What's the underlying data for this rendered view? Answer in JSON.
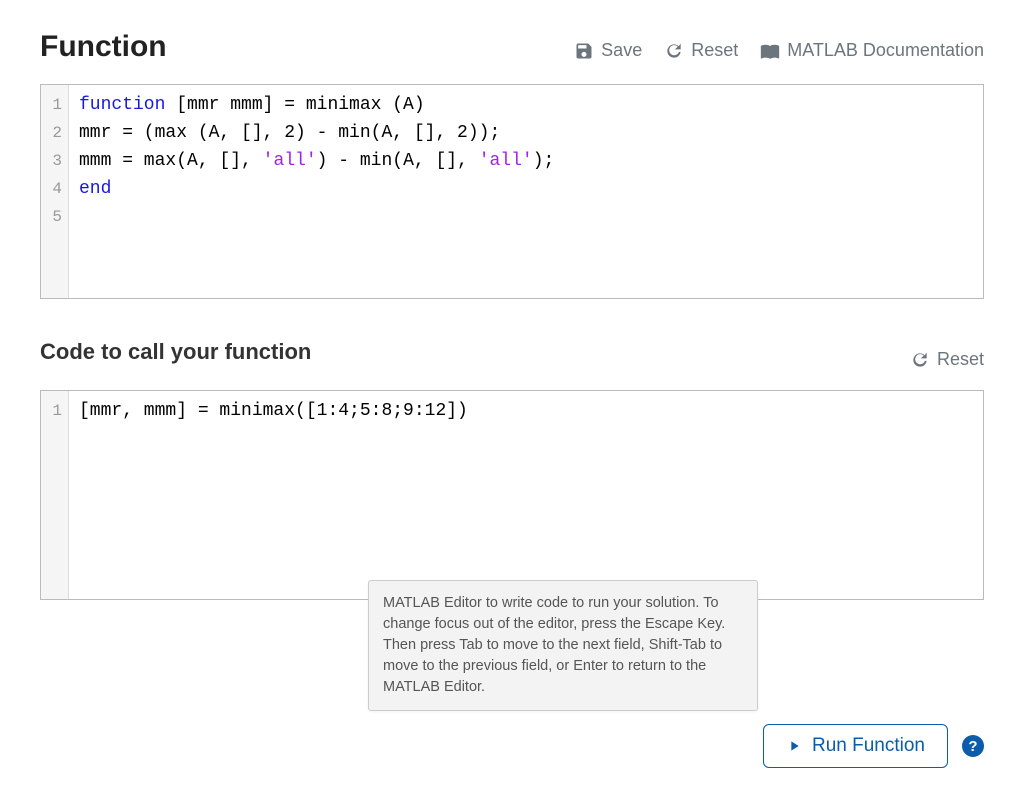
{
  "section1": {
    "title": "Function",
    "toolbar": {
      "save": "Save",
      "reset": "Reset",
      "docs": "MATLAB Documentation"
    },
    "code": {
      "lineNumbers": [
        "1",
        "2",
        "3",
        "4",
        "5"
      ],
      "lines": [
        {
          "tokens": [
            {
              "t": "function",
              "c": "kw"
            },
            {
              "t": " [mmr mmm] = minimax (A)",
              "c": "plain"
            }
          ]
        },
        {
          "tokens": [
            {
              "t": "mmr = (max (A, [], 2) - min(A, [], 2));",
              "c": "plain"
            }
          ]
        },
        {
          "tokens": [
            {
              "t": "mmm = max(A, [], ",
              "c": "plain"
            },
            {
              "t": "'all'",
              "c": "str"
            },
            {
              "t": ") - min(A, [], ",
              "c": "plain"
            },
            {
              "t": "'all'",
              "c": "str"
            },
            {
              "t": ");",
              "c": "plain"
            }
          ]
        },
        {
          "tokens": [
            {
              "t": "end",
              "c": "kw"
            }
          ]
        },
        {
          "tokens": []
        }
      ]
    }
  },
  "section2": {
    "title": "Code to call your function",
    "toolbar": {
      "reset": "Reset"
    },
    "code": {
      "lineNumbers": [
        "1"
      ],
      "lines": [
        {
          "tokens": [
            {
              "t": "[mmr, mmm] = minimax([1:4;5:8;9:12])",
              "c": "plain"
            }
          ]
        }
      ]
    }
  },
  "tooltip": "MATLAB Editor to write code to run your solution. To change focus out of the editor, press the Escape Key. Then press Tab to move to the next field, Shift-Tab to move to the previous field, or Enter to return to the MATLAB Editor.",
  "footer": {
    "run": "Run Function",
    "help": "?"
  }
}
